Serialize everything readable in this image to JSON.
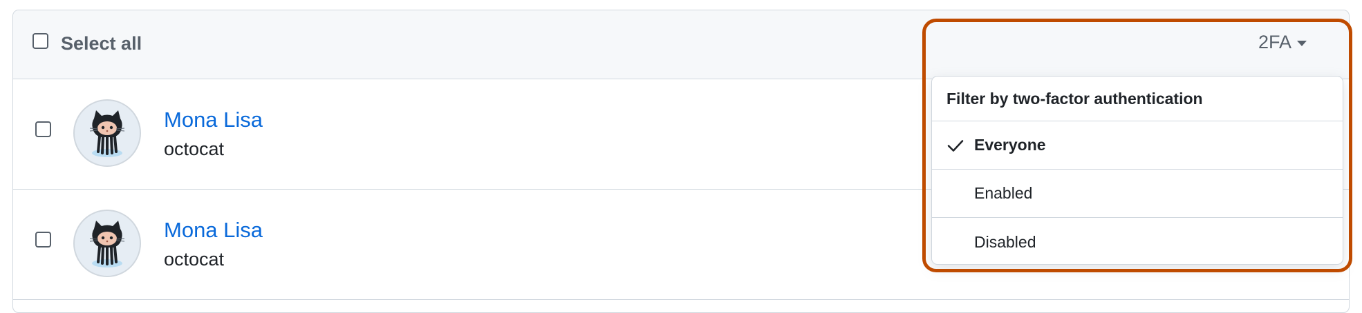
{
  "header": {
    "select_all_label": "Select all",
    "filter_button_label": "2FA"
  },
  "members": [
    {
      "name": "Mona Lisa",
      "login": "octocat"
    },
    {
      "name": "Mona Lisa",
      "login": "octocat"
    }
  ],
  "dropdown": {
    "title": "Filter by two-factor authentication",
    "items": [
      {
        "label": "Everyone",
        "selected": true
      },
      {
        "label": "Enabled",
        "selected": false
      },
      {
        "label": "Disabled",
        "selected": false
      }
    ]
  },
  "icons": {
    "avatar": "octocat-avatar-icon",
    "check": "check-icon",
    "caret": "caret-down-icon"
  },
  "colors": {
    "link": "#0969da",
    "highlight": "#bf4b00",
    "muted_text": "#57606a",
    "border": "#d0d7de",
    "header_bg": "#f6f8fa"
  }
}
